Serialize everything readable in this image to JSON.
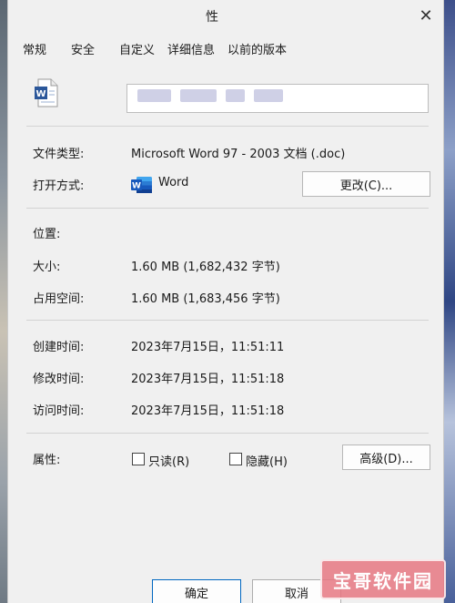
{
  "window": {
    "title": "性"
  },
  "tabs": [
    {
      "label": "常规"
    },
    {
      "label": "安全"
    },
    {
      "label": "自定义"
    },
    {
      "label": "详细信息"
    },
    {
      "label": "以前的版本"
    }
  ],
  "general": {
    "file_type_label": "文件类型:",
    "file_type_value": "Microsoft Word 97 - 2003 文档 (.doc)",
    "open_with_label": "打开方式:",
    "open_with_value": "Word",
    "change_button": "更改(C)...",
    "location_label": "位置:",
    "size_label": "大小:",
    "size_value": "1.60 MB (1,682,432 字节)",
    "size_on_disk_label": "占用空间:",
    "size_on_disk_value": "1.60 MB (1,683,456 字节)",
    "created_label": "创建时间:",
    "created_value": "2023年7月15日，11:51:11",
    "modified_label": "修改时间:",
    "modified_value": "2023年7月15日，11:51:18",
    "accessed_label": "访问时间:",
    "accessed_value": "2023年7月15日，11:51:18",
    "attributes_label": "属性:",
    "readonly_label": "只读(R)",
    "hidden_label": "隐藏(H)",
    "advanced_button": "高级(D)..."
  },
  "footer": {
    "ok_button": "确定",
    "cancel_button": "取消"
  },
  "watermark": "宝哥软件园",
  "colors": {
    "word_blue": "#2b579a",
    "dialog_bg": "#f0f0f0"
  }
}
